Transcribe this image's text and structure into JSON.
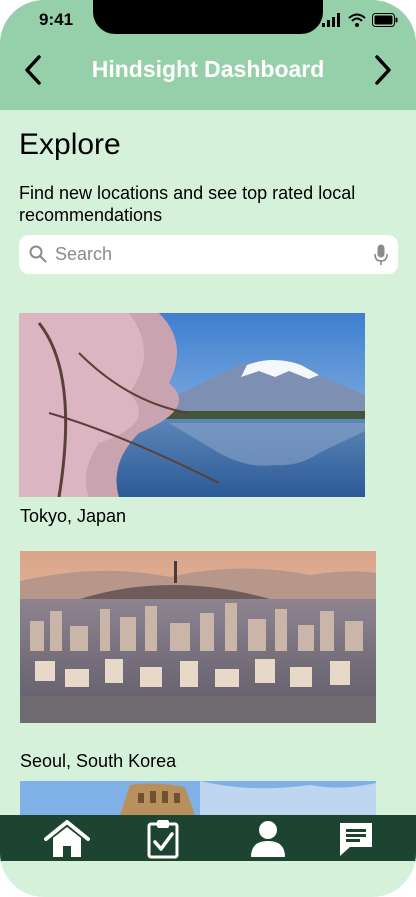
{
  "status": {
    "time": "9:41"
  },
  "header": {
    "title": "Hindsight Dashboard"
  },
  "page": {
    "title": "Explore",
    "subtitle": "Find new locations and see top rated local recommendations"
  },
  "search": {
    "placeholder": "Search"
  },
  "destinations": [
    {
      "label": "Tokyo, Japan"
    },
    {
      "label": "Seoul, South Korea"
    }
  ],
  "tabs": [
    {
      "icon": "home-icon"
    },
    {
      "icon": "clipboard-check-icon"
    },
    {
      "icon": "person-icon"
    },
    {
      "icon": "chat-icon"
    }
  ],
  "colors": {
    "background": "#d6f1da",
    "header": "#95d0ab",
    "tabbar": "#1c4430"
  }
}
